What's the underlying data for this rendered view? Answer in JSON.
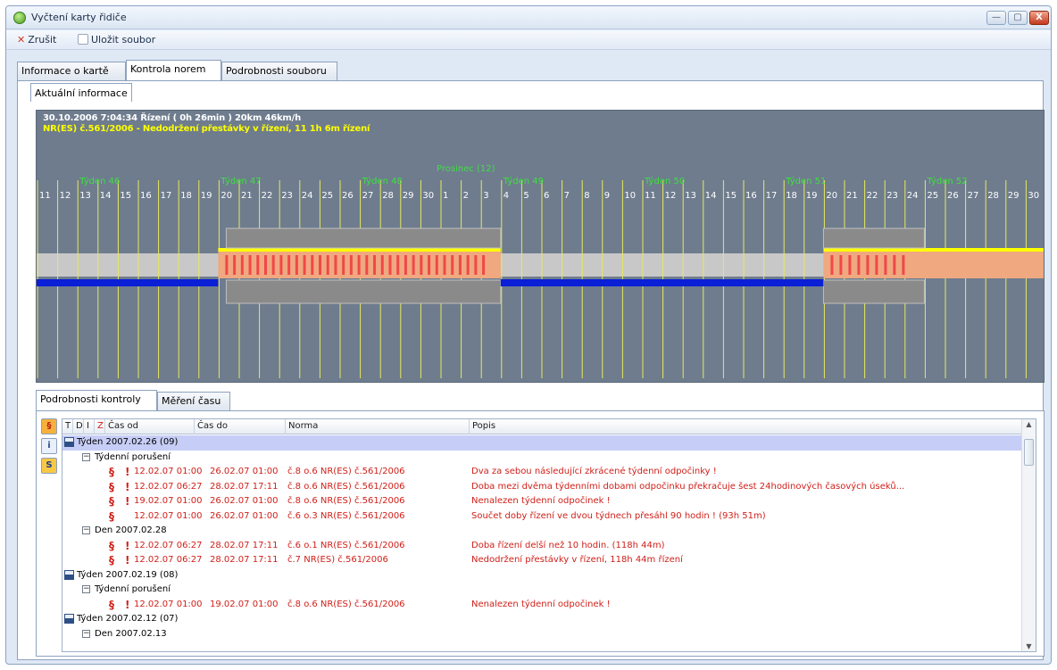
{
  "window": {
    "title": "Vyčtení karty řidiče",
    "buttons": {
      "minimize": "—",
      "maximize": "▢",
      "close": "X"
    }
  },
  "toolbar": {
    "cancel_label": "Zrušit",
    "save_label": "Uložit soubor"
  },
  "main_tabs": [
    {
      "label": "Informace o kartě",
      "active": false
    },
    {
      "label": "Kontrola norem",
      "active": true
    },
    {
      "label": "Podrobnosti souboru",
      "active": false
    }
  ],
  "sub_tab": {
    "label": "Aktuální informace"
  },
  "timeline": {
    "info_line1": "30.10.2006 7:04:34 Řízení ( 0h 26min ) 20km 46km/h",
    "info_line2": "NR(ES) č.561/2006 - Nedodržení přestávky v řízení, 11 1h 6m řízení",
    "days": [
      "11",
      "12",
      "13",
      "14",
      "15",
      "16",
      "17",
      "18",
      "19",
      "20",
      "21",
      "22",
      "23",
      "24",
      "25",
      "26",
      "27",
      "28",
      "29",
      "30",
      "1",
      "2",
      "3",
      "4",
      "5",
      "6",
      "7",
      "8",
      "9",
      "10",
      "11",
      "12",
      "13",
      "14",
      "15",
      "16",
      "17",
      "18",
      "19",
      "20",
      "21",
      "22",
      "23",
      "24",
      "25",
      "26",
      "27",
      "28",
      "29",
      "30"
    ],
    "weeks": [
      {
        "label": "Týden 46",
        "day_index": 2
      },
      {
        "label": "Týden 47",
        "day_index": 9
      },
      {
        "label": "Týden 48",
        "day_index": 16
      },
      {
        "label": "Týden 49",
        "day_index": 23
      },
      {
        "label": "Týden 50",
        "day_index": 30
      },
      {
        "label": "Týden 51",
        "day_index": 37
      },
      {
        "label": "Týden 52",
        "day_index": 44
      }
    ],
    "month_label": {
      "label": "Prosinec (12)",
      "day_index": 20
    },
    "colors": {
      "background": "#6e7c8e",
      "grid_line": "#e8e85a",
      "week_label": "#3ee03e",
      "day_label": "#ffffff",
      "drive_band": "#f0a880",
      "drive_stripe": "#f04848",
      "rest_band": "#c8c8c8",
      "rest_bar": "#0a1fd6",
      "yellow_limit": "#ffff00",
      "gray_block": "#8a8a8a"
    },
    "drive_periods": [
      {
        "from_day": 9.0,
        "to_day": 23.0
      },
      {
        "from_day": 39.0,
        "to_day": 50.0
      }
    ],
    "rest_periods": [
      {
        "from_day": 0.0,
        "to_day": 9.0
      },
      {
        "from_day": 23.0,
        "to_day": 39.0
      }
    ],
    "gray_blocks": [
      {
        "from_day": 9.4,
        "to_day": 23.0
      },
      {
        "from_day": 39.0,
        "to_day": 44.0
      }
    ]
  },
  "detail_tabs": [
    {
      "label": "Podrobnosti kontroly",
      "active": true
    },
    {
      "label": "Měření času",
      "active": false
    }
  ],
  "side_icons": [
    {
      "glyph": "§",
      "name": "paragraph-filter-icon"
    },
    {
      "glyph": "i",
      "name": "info-filter-icon"
    },
    {
      "glyph": "S",
      "name": "summary-filter-icon"
    }
  ],
  "columns": {
    "t": "T",
    "d": "D",
    "i": "I",
    "z": "Z",
    "cas_od": "Čas od",
    "cas_do": "Čas do",
    "norma": "Norma",
    "popis": "Popis"
  },
  "rows": [
    {
      "type": "week",
      "label": "Týden 2007.02.26 (09)",
      "selected": true
    },
    {
      "type": "group",
      "label": "Týdenní porušení"
    },
    {
      "type": "item",
      "para": "§",
      "excl": "!",
      "od": "12.02.07 01:00",
      "do": "26.02.07 01:00",
      "norma": "č.8 o.6 NR(ES) č.561/2006",
      "popis": "Dva za sebou následující zkrácené týdenní odpočinky !"
    },
    {
      "type": "item",
      "para": "§",
      "excl": "!",
      "od": "12.02.07 06:27",
      "do": "28.02.07 17:11",
      "norma": "č.8 o.6 NR(ES) č.561/2006",
      "popis": "Doba mezi dvěma týdenními dobami odpočinku překračuje šest 24hodinových časových úseků..."
    },
    {
      "type": "item",
      "para": "§",
      "excl": "!",
      "od": "19.02.07 01:00",
      "do": "26.02.07 01:00",
      "norma": "č.8 o.6 NR(ES) č.561/2006",
      "popis": "Nenalezen týdenní odpočinek !"
    },
    {
      "type": "item",
      "para": "§",
      "excl": "",
      "od": "12.02.07 01:00",
      "do": "26.02.07 01:00",
      "norma": "č.6 o.3 NR(ES) č.561/2006",
      "popis": "Součet doby řízení ve dvou týdnech přesáhl 90 hodin ! (93h 51m)"
    },
    {
      "type": "group",
      "label": "Den 2007.02.28"
    },
    {
      "type": "item",
      "para": "§",
      "excl": "!",
      "od": "12.02.07 06:27",
      "do": "28.02.07 17:11",
      "norma": "č.6 o.1 NR(ES) č.561/2006",
      "popis": "Doba řízení delší než 10 hodin. (118h 44m)"
    },
    {
      "type": "item",
      "para": "§",
      "excl": "!",
      "od": "12.02.07 06:27",
      "do": "28.02.07 17:11",
      "norma": "č.7 NR(ES) č.561/2006",
      "popis": "Nedodržení přestávky v řízení, 118h 44m řízení"
    },
    {
      "type": "week",
      "label": "Týden 2007.02.19 (08)",
      "selected": false
    },
    {
      "type": "group",
      "label": "Týdenní porušení"
    },
    {
      "type": "item",
      "para": "§",
      "excl": "!",
      "od": "12.02.07 01:00",
      "do": "19.02.07 01:00",
      "norma": "č.8 o.6 NR(ES) č.561/2006",
      "popis": "Nenalezen týdenní odpočinek !"
    },
    {
      "type": "week",
      "label": "Týden 2007.02.12 (07)",
      "selected": false
    },
    {
      "type": "group",
      "label": "Den 2007.02.13"
    }
  ]
}
